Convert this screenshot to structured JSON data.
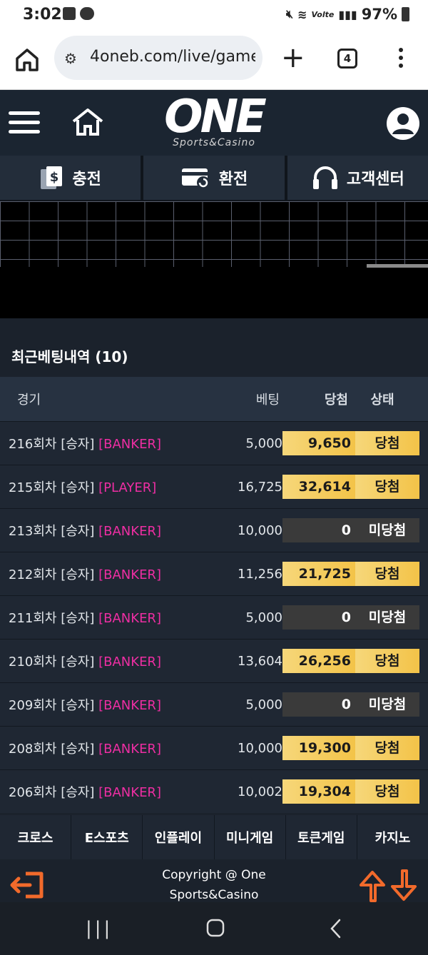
{
  "status_bar": {
    "time": "3:02",
    "battery": "97%",
    "network": "Volte"
  },
  "browser": {
    "url": "4oneb.com/live/game/l",
    "tab_count": "4"
  },
  "header": {
    "logo_main": "ONE",
    "logo_sub": "Sports&Casino"
  },
  "actions": [
    {
      "label": "충전",
      "icon": "deposit-icon"
    },
    {
      "label": "환전",
      "icon": "exchange-icon"
    },
    {
      "label": "고객센터",
      "icon": "headset-icon"
    }
  ],
  "history": {
    "title": "최근베팅내역 (10)",
    "headers": {
      "game": "경기",
      "bet": "베팅",
      "win": "당첨",
      "state": "상태"
    },
    "rows": [
      {
        "round": "216회차 [승자]",
        "pick": "[BANKER]",
        "bet": "5,000",
        "win": "9,650",
        "state": "당첨",
        "won": true
      },
      {
        "round": "215회차 [승자]",
        "pick": "[PLAYER]",
        "bet": "16,725",
        "win": "32,614",
        "state": "당첨",
        "won": true
      },
      {
        "round": "213회차 [승자]",
        "pick": "[BANKER]",
        "bet": "10,000",
        "win": "0",
        "state": "미당첨",
        "won": false
      },
      {
        "round": "212회차 [승자]",
        "pick": "[BANKER]",
        "bet": "11,256",
        "win": "21,725",
        "state": "당첨",
        "won": true
      },
      {
        "round": "211회차 [승자]",
        "pick": "[BANKER]",
        "bet": "5,000",
        "win": "0",
        "state": "미당첨",
        "won": false
      },
      {
        "round": "210회차 [승자]",
        "pick": "[BANKER]",
        "bet": "13,604",
        "win": "26,256",
        "state": "당첨",
        "won": true
      },
      {
        "round": "209회차 [승자]",
        "pick": "[BANKER]",
        "bet": "5,000",
        "win": "0",
        "state": "미당첨",
        "won": false
      },
      {
        "round": "208회차 [승자]",
        "pick": "[BANKER]",
        "bet": "10,000",
        "win": "19,300",
        "state": "당첨",
        "won": true
      },
      {
        "round": "206회차 [승자]",
        "pick": "[BANKER]",
        "bet": "10,002",
        "win": "19,304",
        "state": "당첨",
        "won": true
      }
    ]
  },
  "bottom_tabs": [
    "크로스",
    "E스포츠",
    "인플레이",
    "미니게임",
    "토큰게임",
    "카지노"
  ],
  "footer": {
    "copyright_line1": "Copyright @ One",
    "copyright_line2": "Sports&Casino"
  },
  "colors": {
    "accent_orange": "#f26a2b",
    "pick_pink": "#ee2ea3",
    "win_gold": "#f3c348"
  }
}
